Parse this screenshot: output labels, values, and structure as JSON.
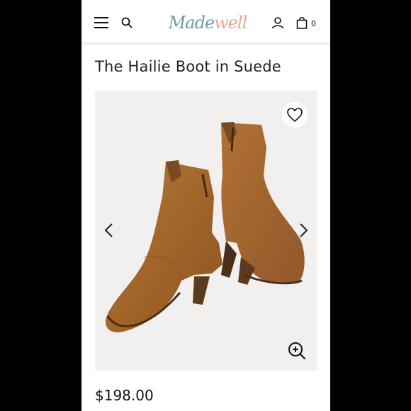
{
  "header": {
    "logo_text": "Madewell",
    "logo_main": "Made",
    "logo_tail": "well",
    "bag_count": "0",
    "icons": [
      "hamburger-menu-icon",
      "search-icon",
      "account-icon",
      "shopping-bag-icon"
    ],
    "logo_colors": {
      "main": "#6e9aa3",
      "tail": "#e6a48f"
    }
  },
  "product": {
    "title": "The Hailie Boot in Suede",
    "price": "$198.00",
    "image": {
      "description_icon": "boots-image",
      "controls": [
        "favorite-heart-icon",
        "previous-arrow-icon",
        "next-arrow-icon",
        "zoom-in-icon"
      ]
    }
  },
  "colors": {
    "background": "#000000",
    "page": "#ffffff",
    "image_bg": "#f1f0ef",
    "suede": "#a8692b"
  }
}
